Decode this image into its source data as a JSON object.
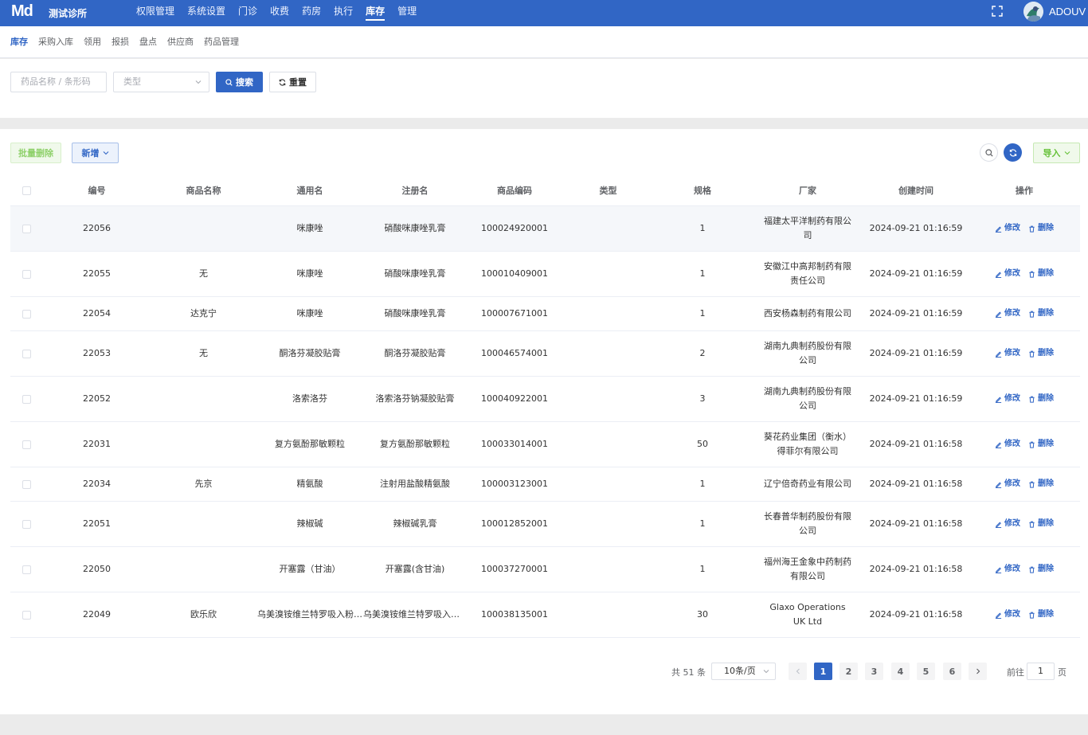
{
  "header": {
    "logo": "Md",
    "clinic_name": "测试诊所",
    "nav": [
      "权限管理",
      "系统设置",
      "门诊",
      "收费",
      "药房",
      "执行",
      "库存",
      "管理"
    ],
    "active_nav": "库存",
    "username": "ADOUV",
    "brand_color": "#3166c5"
  },
  "subnav": {
    "items": [
      "库存",
      "采购入库",
      "领用",
      "报损",
      "盘点",
      "供应商",
      "药品管理"
    ],
    "active": "库存"
  },
  "filter": {
    "search_placeholder": "药品名称 / 条形码",
    "type_placeholder": "类型",
    "search_label": "搜索",
    "reset_label": "重置"
  },
  "toolbar": {
    "batch_delete_label": "批量删除",
    "add_label": "新增",
    "import_label": "导入"
  },
  "table": {
    "columns": [
      "编号",
      "商品名称",
      "通用名",
      "注册名",
      "商品编码",
      "类型",
      "规格",
      "厂家",
      "创建时间",
      "操作"
    ],
    "edit_label": "修改",
    "delete_label": "删除",
    "rows": [
      {
        "id": "22056",
        "name": "",
        "generic": "咪康唑",
        "reg": "硝酸咪康唑乳膏",
        "code": "100024920001",
        "type": "",
        "spec": "1",
        "maker": "福建太平洋制药有限公司",
        "created": "2024-09-21 01:16:59"
      },
      {
        "id": "22055",
        "name": "无",
        "generic": "咪康唑",
        "reg": "硝酸咪康唑乳膏",
        "code": "100010409001",
        "type": "",
        "spec": "1",
        "maker": "安徽江中高邦制药有限责任公司",
        "created": "2024-09-21 01:16:59"
      },
      {
        "id": "22054",
        "name": "达克宁",
        "generic": "咪康唑",
        "reg": "硝酸咪康唑乳膏",
        "code": "100007671001",
        "type": "",
        "spec": "1",
        "maker": "西安杨森制药有限公司",
        "created": "2024-09-21 01:16:59"
      },
      {
        "id": "22053",
        "name": "无",
        "generic": "酮洛芬凝胶贴膏",
        "reg": "酮洛芬凝胶贴膏",
        "code": "100046574001",
        "type": "",
        "spec": "2",
        "maker": "湖南九典制药股份有限公司",
        "created": "2024-09-21 01:16:59"
      },
      {
        "id": "22052",
        "name": "",
        "generic": "洛索洛芬",
        "reg": "洛索洛芬钠凝胶贴膏",
        "code": "100040922001",
        "type": "",
        "spec": "3",
        "maker": "湖南九典制药股份有限公司",
        "created": "2024-09-21 01:16:59"
      },
      {
        "id": "22031",
        "name": "",
        "generic": "复方氨酚那敏颗粒",
        "reg": "复方氨酚那敏颗粒",
        "code": "100033014001",
        "type": "",
        "spec": "50",
        "maker": "葵花药业集团（衡水）得菲尔有限公司",
        "created": "2024-09-21 01:16:58"
      },
      {
        "id": "22034",
        "name": "先京",
        "generic": "精氨酸",
        "reg": "注射用盐酸精氨酸",
        "code": "100003123001",
        "type": "",
        "spec": "1",
        "maker": "辽宁倍奇药业有限公司",
        "created": "2024-09-21 01:16:58"
      },
      {
        "id": "22051",
        "name": "",
        "generic": "辣椒碱",
        "reg": "辣椒碱乳膏",
        "code": "100012852001",
        "type": "",
        "spec": "1",
        "maker": "长春普华制药股份有限公司",
        "created": "2024-09-21 01:16:58"
      },
      {
        "id": "22050",
        "name": "",
        "generic": "开塞露（甘油）",
        "reg": "开塞露(含甘油)",
        "code": "100037270001",
        "type": "",
        "spec": "1",
        "maker": "福州海王金象中药制药有限公司",
        "created": "2024-09-21 01:16:58"
      },
      {
        "id": "22049",
        "name": "欧乐欣",
        "generic": "乌美溴铵维兰特罗吸入粉雾剂",
        "reg": "乌美溴铵维兰特罗吸入粉雾剂",
        "code": "100038135001",
        "type": "",
        "spec": "30",
        "maker": "Glaxo Operations UK Ltd",
        "created": "2024-09-21 01:16:58"
      }
    ]
  },
  "pagination": {
    "total_text": "共 51 条",
    "page_size": "10条/页",
    "pages": [
      "1",
      "2",
      "3",
      "4",
      "5",
      "6"
    ],
    "current": "1",
    "goto_label": "前往",
    "goto_value": "1",
    "goto_suffix": "页"
  }
}
